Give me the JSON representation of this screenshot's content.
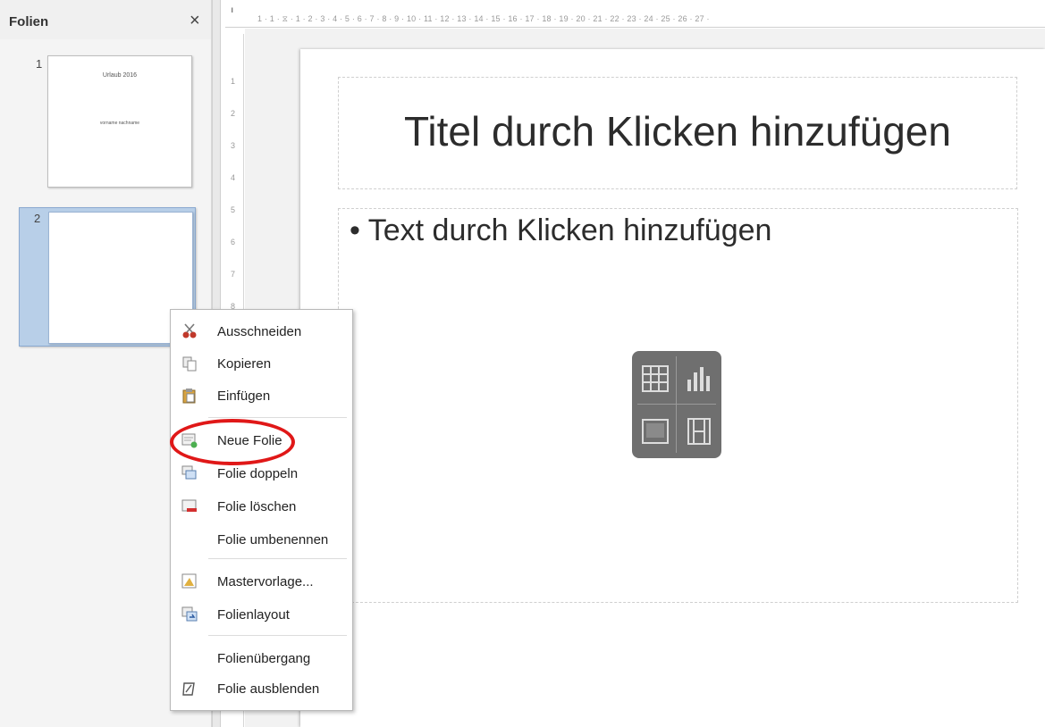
{
  "pane": {
    "title": "Folien",
    "close_icon": "close-icon",
    "slides": [
      {
        "number": "1",
        "title_text": "Urlaub 2016",
        "subtitle_text": "vorname nachname"
      },
      {
        "number": "2"
      }
    ]
  },
  "ruler": {
    "h_ticks": "1 · 1 · ⧖ · 1 · 2 · 3 · 4 · 5 · 6 · 7 · 8 · 9 · 10 · 11 · 12 · 13 · 14 · 15 · 16 · 17 · 18 · 19 · 20 · 21 · 22 · 23 · 24 · 25 · 26 · 27 ·",
    "v_ticks": [
      "1",
      "2",
      "3",
      "4",
      "5",
      "6",
      "7",
      "8"
    ]
  },
  "slide": {
    "title_placeholder": "Titel durch Klicken hinzufügen",
    "content_placeholder": "• Text durch Klicken hinzufügen",
    "insert_icons": [
      "table-icon",
      "chart-icon",
      "image-icon",
      "video-icon"
    ]
  },
  "context_menu": {
    "items": [
      {
        "label": "Ausschneiden",
        "icon": "scissors-icon"
      },
      {
        "label": "Kopieren",
        "icon": "copy-icon"
      },
      {
        "label": "Einfügen",
        "icon": "paste-icon"
      },
      {
        "label": "Neue Folie",
        "icon": "new-slide-icon"
      },
      {
        "label": "Folie doppeln",
        "icon": "duplicate-slide-icon"
      },
      {
        "label": "Folie löschen",
        "icon": "delete-slide-icon"
      },
      {
        "label": "Folie umbenennen",
        "icon": ""
      },
      {
        "label": "Mastervorlage...",
        "icon": "master-slide-icon"
      },
      {
        "label": "Folienlayout",
        "icon": "slide-layout-icon"
      },
      {
        "label": "Folienübergang",
        "icon": ""
      },
      {
        "label": "Folie ausblenden",
        "icon": "hide-slide-icon"
      }
    ]
  },
  "colors": {
    "highlight_ring": "#e01818",
    "selected_slide": "#b8cfe8"
  }
}
